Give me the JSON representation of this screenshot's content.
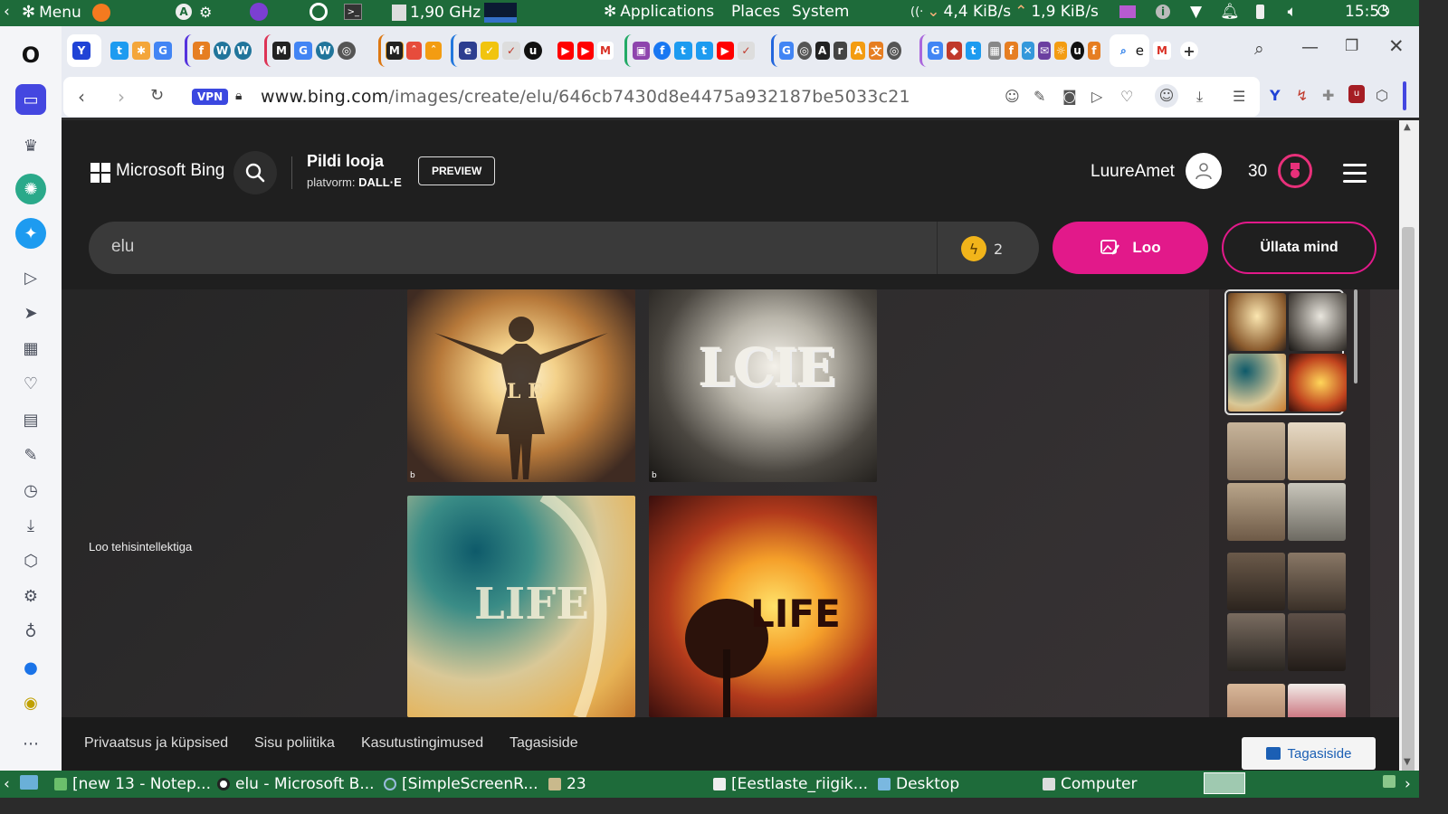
{
  "system_panel": {
    "menu_label": "Menu",
    "cpu_freq": "1,90 GHz",
    "applications_label": "Applications",
    "places_label": "Places",
    "system_label": "System",
    "net_down": "4,4 KiB/s",
    "net_up": "1,9 KiB/s",
    "clock": "15:53"
  },
  "browser": {
    "url_domain": "www.bing.com",
    "url_path": "/images/create/elu/646cb7430d8e4475a932187be5033c21",
    "vpn_label": "VPN",
    "active_tab_letter": "e"
  },
  "bing": {
    "brand": "Microsoft Bing",
    "page_title": "Pildi looja",
    "platform_prefix": "platvorm: ",
    "platform_name": "DALL·E",
    "preview_label": "PREVIEW",
    "username": "LuureAmet",
    "points": "30",
    "prompt_value": "elu",
    "boosts": "2",
    "create_label": "Loo",
    "surprise_label": "Üllata mind",
    "ai_side_label": "Loo tehisintellektiga",
    "image_badge": "b",
    "footer": {
      "privacy": "Privaatsus ja küpsised",
      "content_policy": "Sisu poliitika",
      "terms": "Kasutustingimused",
      "feedback": "Tagasiside",
      "feedback_button": "Tagasiside"
    }
  },
  "images": [
    {
      "word": "L E",
      "accent": "#f2d9a3"
    },
    {
      "word": "LCIE",
      "accent": "#f1efe8"
    },
    {
      "word": "LIFE",
      "accent": "#f6f0d8"
    },
    {
      "word": "LIFE",
      "accent": "#2b0d08"
    }
  ],
  "taskbar": {
    "items": [
      "[new 13 - Notep...",
      "elu - Microsoft B...",
      "[SimpleScreenR...",
      "23",
      "[Eestlaste_riigik...",
      "Desktop",
      "Computer"
    ]
  },
  "colors": {
    "panel_green": "#1e6b3a",
    "bing_pink": "#e2198a",
    "boost_gold": "#f1b41a"
  }
}
